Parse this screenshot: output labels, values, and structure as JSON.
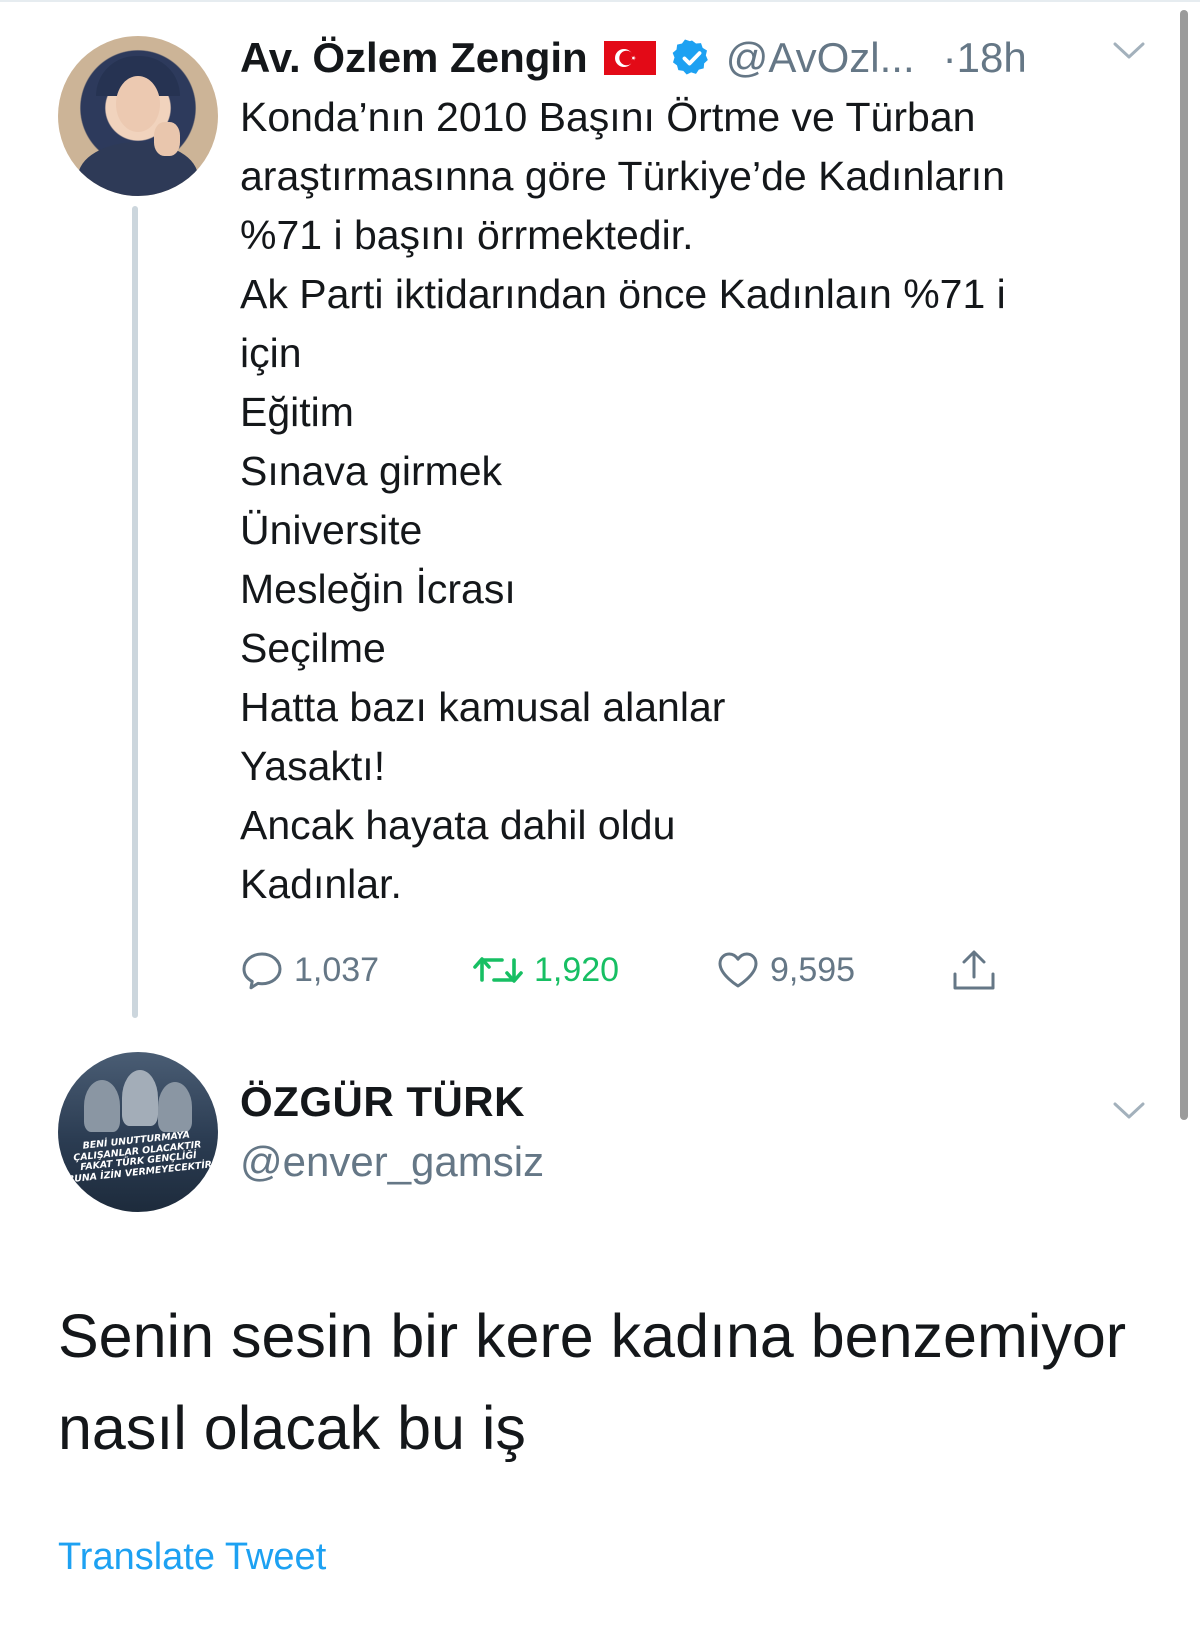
{
  "colors": {
    "text": "#14171a",
    "secondary": "#657786",
    "link": "#1da1f2",
    "retweet": "#17bf63",
    "verified": "#1da1f2",
    "flag": "#e30a17"
  },
  "tweet": {
    "author_name": "Av. Özlem Zengin",
    "flag_icon": "turkey-flag-icon",
    "verified_icon": "verified-badge-icon",
    "handle": "@AvOzl...",
    "time": "·18h",
    "text_lines": [
      "Konda’nın 2010 Başını Örtme ve Türban",
      "araştırmasınna göre Türkiye’de Kadınların",
      "%71 i başını örrmektedir.",
      "Ak Parti iktidarından önce Kadınlaın %71 i",
      "için",
      "Eğitim",
      "Sınava girmek",
      "Üniversite",
      "Mesleğin İcrası",
      "Seçilme",
      "Hatta bazı kamusal alanlar",
      "Yasaktı!",
      "Ancak hayata dahil oldu",
      "Kadınlar."
    ],
    "actions": {
      "replies": "1,037",
      "retweets": "1,920",
      "likes": "9,595"
    }
  },
  "reply": {
    "author_name": "ÖZGÜR TÜRK",
    "handle": "@enver_gamsiz",
    "avatar_caption": [
      "BENİ UNUTTURMAYA",
      "ÇALIŞANLAR OLACAKTIR",
      "FAKAT TÜRK GENÇLİĞİ",
      "BUNA İZİN VERMEYECEKTİR"
    ],
    "text_lines": [
      "Senin sesin bir kere kadına benzemiyor",
      "nasıl olacak bu iş"
    ],
    "translate_label": "Translate Tweet"
  }
}
